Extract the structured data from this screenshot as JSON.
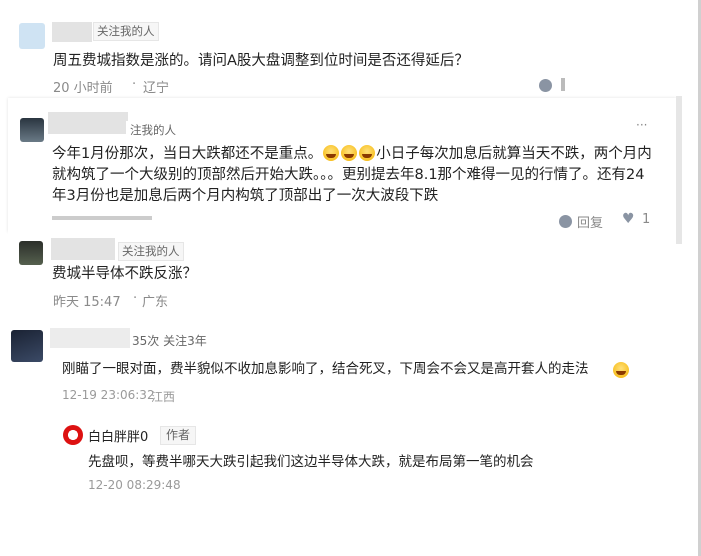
{
  "comments": [
    {
      "follow_tag": "关注我的人",
      "text": "周五费城指数是涨的。请问A股大盘调整到位时间是否还得延后？",
      "time": "20 小时前",
      "sep": "·",
      "location": "辽宁"
    },
    {
      "follow_tag": "注我的人",
      "text_part1": "今年1月份那次，当日大跌都还不是重点。",
      "text_part2": "小日子每次加息后就算当天不跌，两个月内就构筑了一个大级别的顶部然后开始大跌。。。更别提去年8.1那个难得一见的行情了。还有24年3月份也是加息后两个月内构筑了顶部出了一次大波段下跌",
      "more": "···",
      "reply_label": "回复",
      "like_count": "1"
    },
    {
      "follow_tag": "关注我的人",
      "text": "费城半导体不跌反涨？",
      "time": "昨天 15:47",
      "sep": "·",
      "location": "广东"
    },
    {
      "tag": "35次 关注3年",
      "text": "刚瞄了一眼对面，费半貌似不收加息影响了，结合死叉，下周会不会又是高开套人的走法",
      "time": "12-19 23:06:32",
      "location": "江西"
    }
  ],
  "reply": {
    "username": "白白胖胖0",
    "author_tag": "作者",
    "text": "先盘呗，等费半哪天大跌引起我们这边半导体大跌，就是布局第一笔的机会",
    "time": "12-20 08:29:48"
  }
}
